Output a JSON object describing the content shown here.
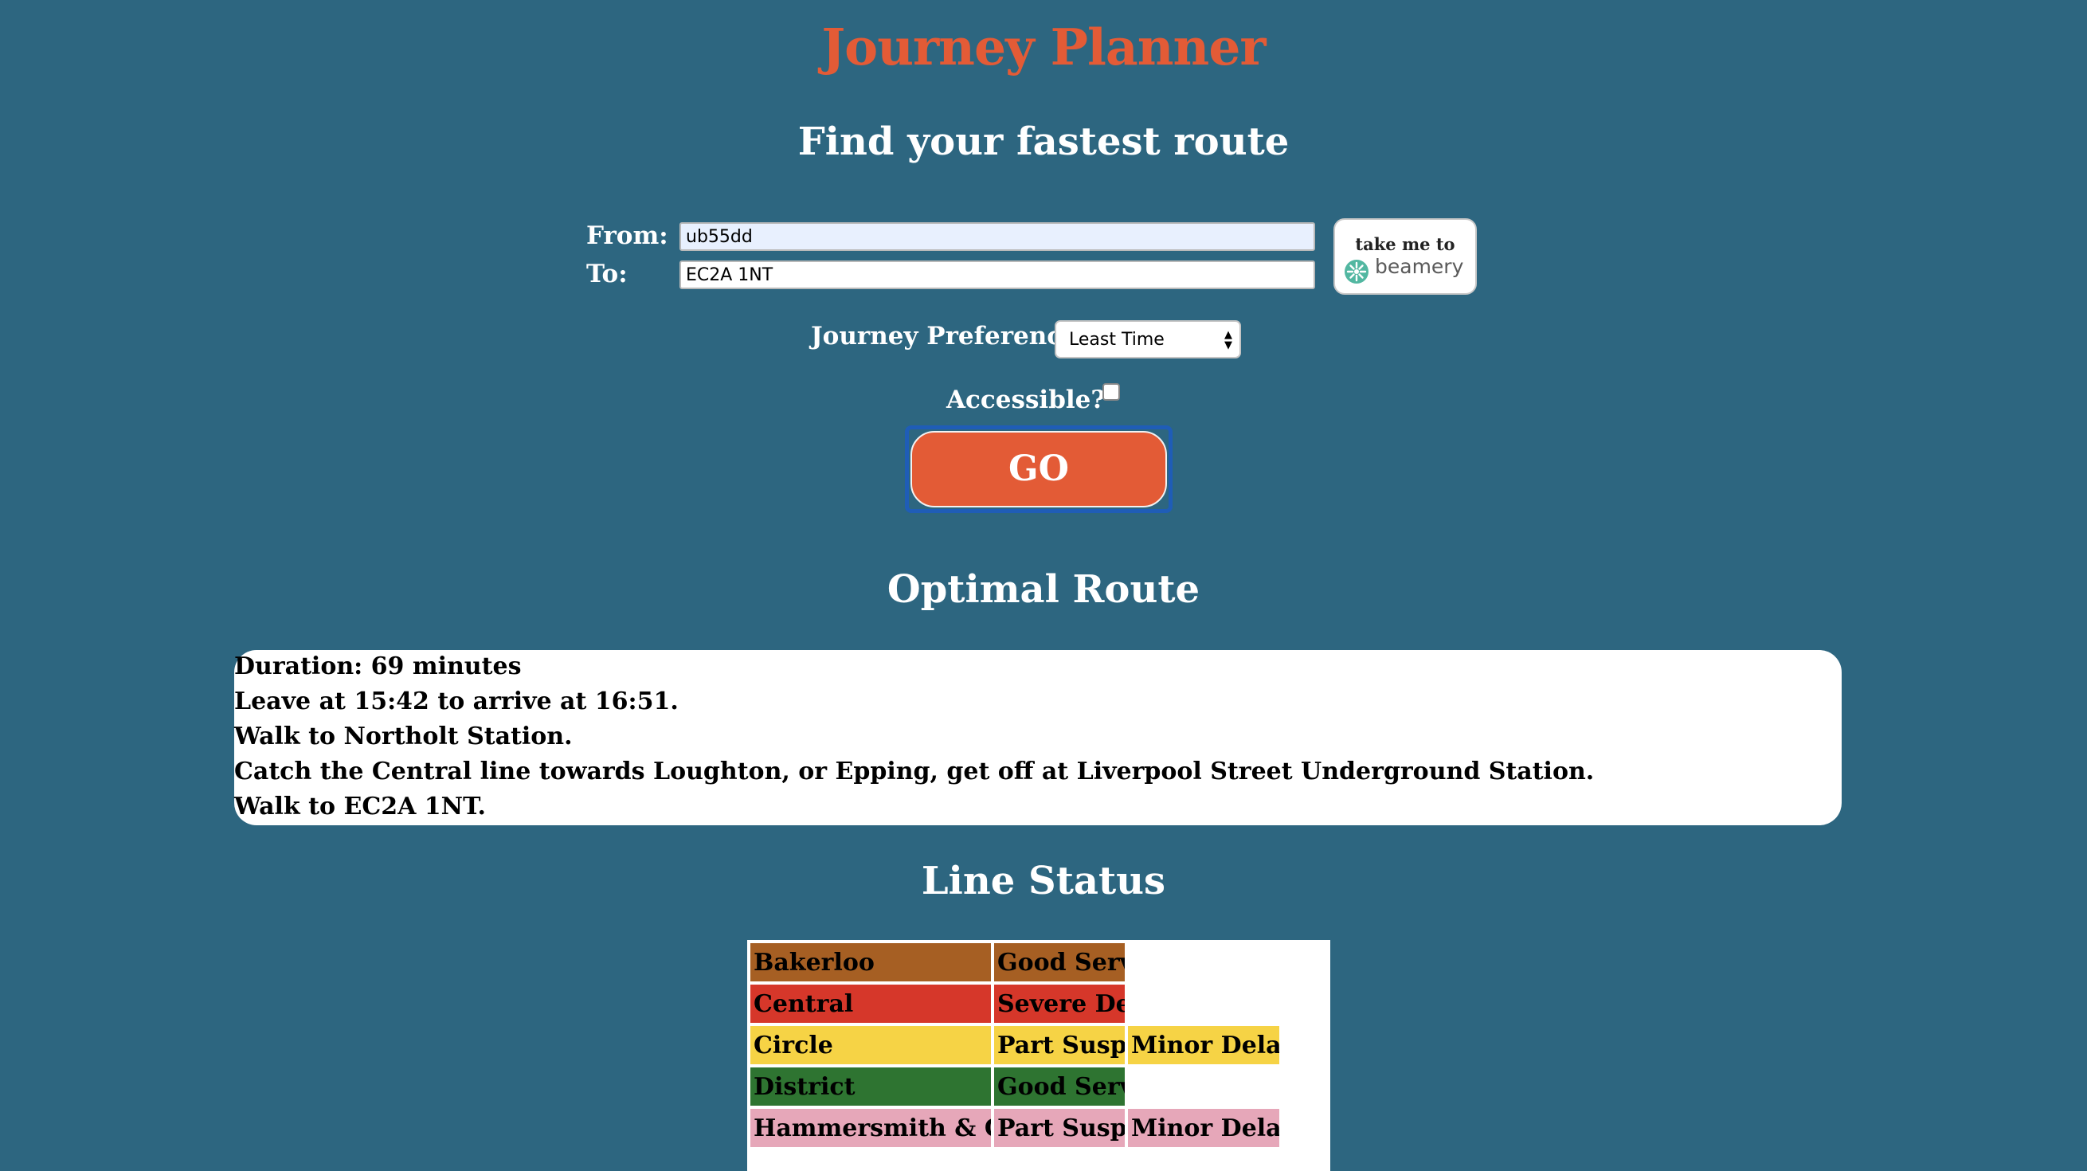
{
  "header": {
    "title": "Journey Planner",
    "subtitle": "Find your fastest route"
  },
  "form": {
    "from_label": "From:",
    "from_value": "ub55dd",
    "to_label": "To:",
    "to_value": "EC2A 1NT",
    "beamery_button": {
      "label": "take me to",
      "brand": "beamery",
      "icon": "beamery-logo-icon"
    },
    "preference_label": "Journey Preference",
    "preference_value": "Least Time",
    "accessible_label": "Accessible?",
    "accessible_checked": false,
    "go_label": "GO"
  },
  "route": {
    "title": "Optimal Route",
    "lines": [
      "Duration: 69 minutes",
      "Leave at 15:42 to arrive at 16:51.",
      "Walk to Northolt Station.",
      "Catch the Central line towards Loughton, or Epping, get off at Liverpool Street Underground Station.",
      "Walk to EC2A 1NT."
    ]
  },
  "line_status": {
    "title": "Line Status",
    "rows": [
      {
        "line": "Bakerloo",
        "status": "Good Service",
        "extra": "",
        "color": "#a65f23"
      },
      {
        "line": "Central",
        "status": "Severe Delays",
        "extra": "",
        "color": "#d6372a"
      },
      {
        "line": "Circle",
        "status": "Part Suspended",
        "extra": "Minor Delays",
        "color": "#f6d345"
      },
      {
        "line": "District",
        "status": "Good Service",
        "extra": "",
        "color": "#2e7431"
      },
      {
        "line": "Hammersmith & City",
        "status": "Part Suspended",
        "extra": "Minor Delays",
        "color": "#e6a7b9"
      }
    ]
  },
  "colors": {
    "background": "#2d6680",
    "accent": "#e35b36",
    "focus_ring": "#1f5db7"
  }
}
